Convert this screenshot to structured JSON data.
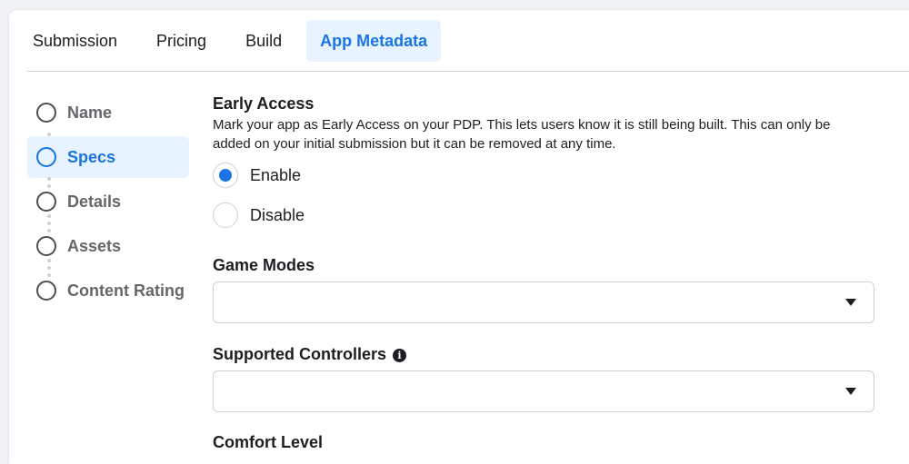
{
  "tabs": [
    {
      "label": "Submission"
    },
    {
      "label": "Pricing"
    },
    {
      "label": "Build"
    },
    {
      "label": "App Metadata"
    }
  ],
  "active_tab": "App Metadata",
  "stepper": {
    "steps": [
      {
        "label": "Name"
      },
      {
        "label": "Specs"
      },
      {
        "label": "Details"
      },
      {
        "label": "Assets"
      },
      {
        "label": "Content Rating"
      }
    ],
    "active_step": "Specs"
  },
  "early_access": {
    "title": "Early Access",
    "description": "Mark your app as Early Access on your PDP. This lets users know it is still being built. This can only be added on your initial submission but it can be removed at any time.",
    "options": [
      {
        "label": "Enable",
        "selected": true
      },
      {
        "label": "Disable",
        "selected": false
      }
    ]
  },
  "game_modes": {
    "title": "Game Modes",
    "value": ""
  },
  "supported_controllers": {
    "title": "Supported Controllers",
    "value": "",
    "icon": "info-icon"
  },
  "comfort_level": {
    "title": "Comfort Level"
  },
  "colors": {
    "accent": "#1b74e4",
    "accent_bg": "#e7f3ff",
    "border": "#ced0d4",
    "muted_text": "#65676b"
  }
}
